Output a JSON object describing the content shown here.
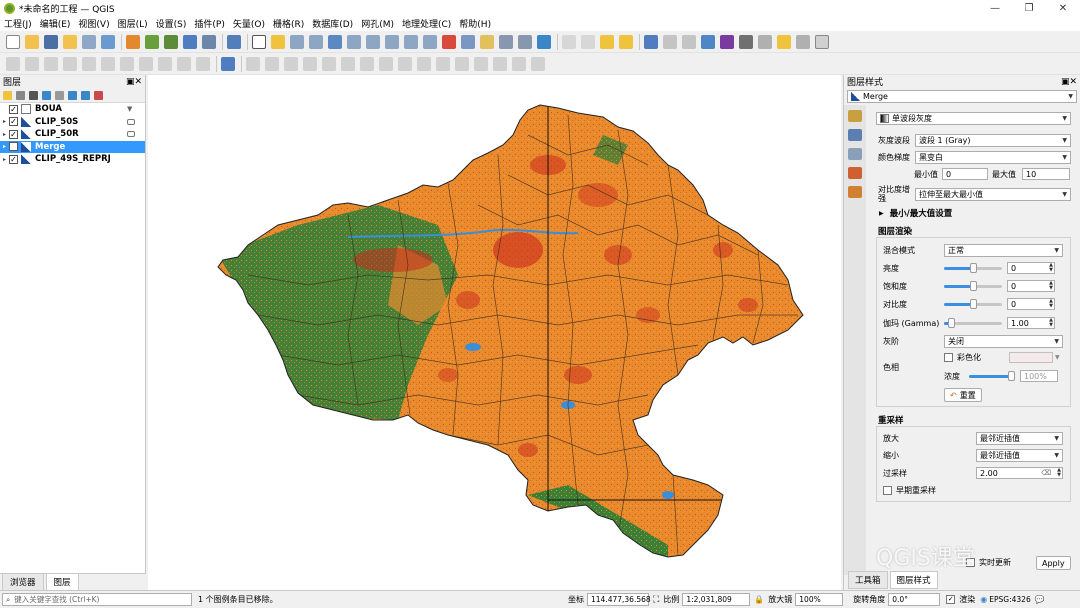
{
  "window": {
    "title": "*未命名的工程 — QGIS",
    "minimize": "—",
    "maximize": "❐",
    "close": "✕"
  },
  "menu": [
    "工程(J)",
    "编辑(E)",
    "视图(V)",
    "图层(L)",
    "设置(S)",
    "插件(P)",
    "矢量(O)",
    "栅格(R)",
    "数据库(D)",
    "网孔(M)",
    "地理处理(C)",
    "帮助(H)"
  ],
  "layers_panel": {
    "title": "图层",
    "layers": [
      {
        "name": "BOUA",
        "checked": true,
        "selected": false,
        "expander": ""
      },
      {
        "name": "CLIP_50S",
        "checked": true,
        "selected": false,
        "expander": "▸"
      },
      {
        "name": "CLIP_50R",
        "checked": true,
        "selected": false,
        "expander": "▸"
      },
      {
        "name": "Merge",
        "checked": true,
        "selected": true,
        "expander": "▸"
      },
      {
        "name": "CLIP_49S_REPRJ",
        "checked": true,
        "selected": false,
        "expander": "▸"
      }
    ],
    "tabs": [
      "浏览器",
      "图层"
    ]
  },
  "style_panel": {
    "title": "图层样式",
    "layer_select": "Merge",
    "renderer": "单波段灰度",
    "gray_band_label": "灰度波段",
    "gray_band_value": "波段 1 (Gray)",
    "color_gradient_label": "颜色梯度",
    "color_gradient_value": "黑变白",
    "min_label": "最小值",
    "min_value": "0",
    "max_label": "最大值",
    "max_value": "10",
    "contrast_label": "对比度增强",
    "contrast_value": "拉伸至最大最小值",
    "minmax_settings": "最小/最大值设置",
    "rendering_header": "图层渲染",
    "blend_label": "混合模式",
    "blend_value": "正常",
    "brightness_label": "亮度",
    "brightness_value": "0",
    "saturation_label": "饱和度",
    "saturation_value": "0",
    "contrast2_label": "对比度",
    "contrast2_value": "0",
    "gamma_label": "伽玛 (Gamma)",
    "gamma_value": "1.00",
    "grayscale_label": "灰阶",
    "grayscale_value": "关闭",
    "hue_label": "色相",
    "colorize_label": "彩色化",
    "strength_label": "浓度",
    "strength_value": "100%",
    "reset_label": "重置",
    "resampling_header": "重采样",
    "zoomin_label": "放大",
    "zoomin_value": "最邻近插值",
    "zoomout_label": "缩小",
    "zoomout_value": "最邻近插值",
    "oversampling_label": "过采样",
    "oversampling_value": "2.00",
    "early_resample_label": "早期重采样",
    "live_update": "实时更新",
    "apply": "Apply",
    "tabs": [
      "工具箱",
      "图层样式"
    ]
  },
  "statusbar": {
    "search_placeholder": "键入关键字查找 (Ctrl+K)",
    "message": "1 个图例条目已移除。",
    "coord_label": "坐标",
    "coord_value": "114.477,36.568",
    "scale_label": "比例",
    "scale_value": "1:2,031,809",
    "magnifier_label": "放大镜",
    "magnifier_value": "100%",
    "rotation_label": "旋转角度",
    "rotation_value": "0.0°",
    "render_label": "渲染",
    "crs": "EPSG:4326"
  },
  "watermark": "QGIS课堂",
  "colors": {
    "orange": "#e98a2d",
    "green": "#3d7e35",
    "red": "#cc2a1e",
    "blue": "#3a8fd8",
    "selection": "#3399ff"
  }
}
